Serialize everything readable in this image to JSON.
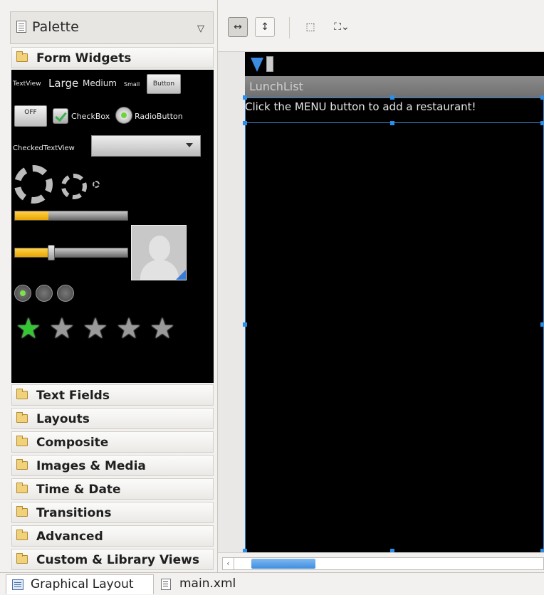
{
  "palette": {
    "title": "Palette",
    "menu_glyph": "▽",
    "categories": [
      {
        "label": "Form Widgets",
        "expanded": true
      },
      {
        "label": "Text Fields"
      },
      {
        "label": "Layouts"
      },
      {
        "label": "Composite"
      },
      {
        "label": "Images & Media"
      },
      {
        "label": "Time & Date"
      },
      {
        "label": "Transitions"
      },
      {
        "label": "Advanced"
      },
      {
        "label": "Custom & Library Views"
      }
    ],
    "form_widgets": {
      "textview_small": "TextView",
      "large": "Large",
      "medium": "Medium",
      "small": "Small",
      "button": "Button",
      "toggle": "OFF",
      "checkbox": "CheckBox",
      "radiobutton": "RadioButton",
      "checked_textview": "CheckedTextView",
      "progress_fraction": 0.3,
      "seekbar_fraction": 0.32,
      "page_dots": 3,
      "active_page": 1,
      "rating": 1,
      "rating_max": 5
    }
  },
  "toolbar": {
    "toggle_fill_width": "↔",
    "toggle_fill_height": "↕",
    "zoom_fit": "⬚",
    "zoom_menu": "⛶⌄"
  },
  "device": {
    "app_title": "LunchList",
    "hint_text": "Click the MENU button to add a restaurant!"
  },
  "tabs": {
    "graphical": "Graphical Layout",
    "xml": "main.xml"
  },
  "scrollbar": {
    "left_arrow": "‹"
  },
  "colors": {
    "accent_blue": "#2a8fe8",
    "progress_yellow": "#f0b400",
    "star_active": "#32c832"
  }
}
